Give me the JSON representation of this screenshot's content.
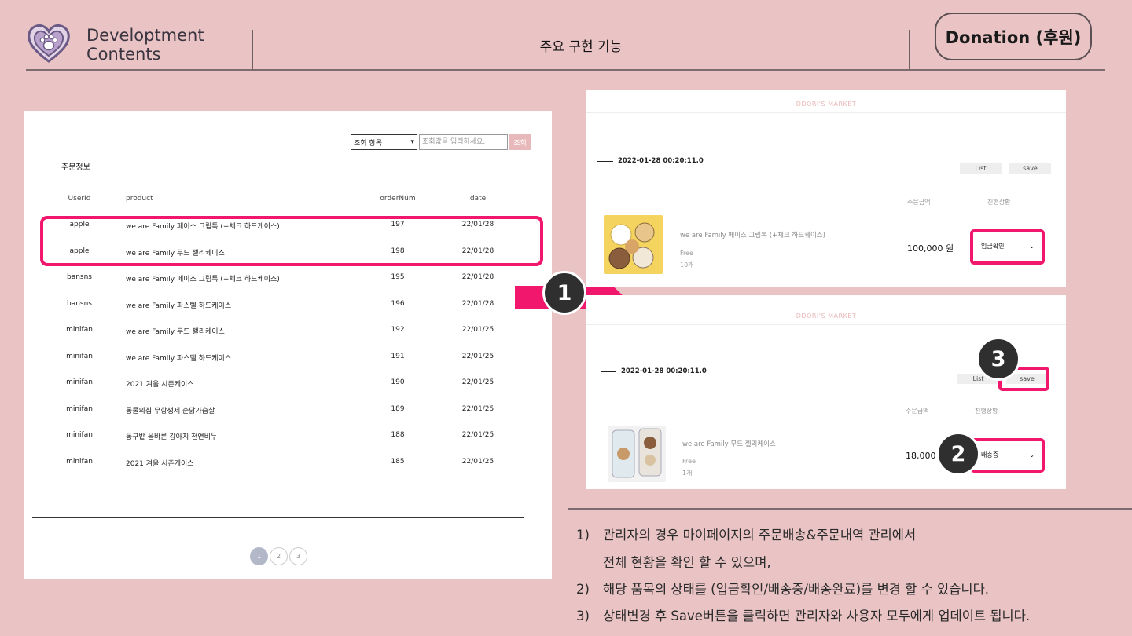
{
  "header": {
    "brand_line1": "Developtment",
    "brand_line2": "Contents",
    "title": "주요 구현 기능",
    "donation_label": "Donation (후원)"
  },
  "colors": {
    "background": "#eac4c5",
    "highlight": "#f1176c",
    "badge": "#2f2f2f"
  },
  "admin": {
    "search_select_value": "조회 항목",
    "search_placeholder": "조회값을 입력하세요.",
    "search_button": "조회",
    "section_title": "주문정보",
    "columns": [
      "UserId",
      "product",
      "orderNum",
      "date"
    ],
    "rows": [
      {
        "user": "apple",
        "product": "we are Family 페이스 그립톡 (+체크 하드케이스)",
        "num": "197",
        "date": "22/01/28"
      },
      {
        "user": "apple",
        "product": "we are Family 무드 젤리케이스",
        "num": "198",
        "date": "22/01/28"
      },
      {
        "user": "bansns",
        "product": "we are Family 페이스 그립톡 (+체크 하드케이스)",
        "num": "195",
        "date": "22/01/28"
      },
      {
        "user": "bansns",
        "product": "we are Family 파스텔 하드케이스",
        "num": "196",
        "date": "22/01/28"
      },
      {
        "user": "minifan",
        "product": "we are Family 무드 젤리케이스",
        "num": "192",
        "date": "22/01/25"
      },
      {
        "user": "minifan",
        "product": "we are Family 파스텔 하드케이스",
        "num": "191",
        "date": "22/01/25"
      },
      {
        "user": "minifan",
        "product": "2021 겨울 시즌케이스",
        "num": "190",
        "date": "22/01/25"
      },
      {
        "user": "minifan",
        "product": "동물의집 무항생제 순닭가슴살",
        "num": "189",
        "date": "22/01/25"
      },
      {
        "user": "minifan",
        "product": "동구밭 올바른 강아지 천연비누",
        "num": "188",
        "date": "22/01/25"
      },
      {
        "user": "minifan",
        "product": "2021 겨울 시즌케이스",
        "num": "185",
        "date": "22/01/25"
      }
    ],
    "pages": [
      "1",
      "2",
      "3"
    ],
    "active_page": "1"
  },
  "badges": [
    "1",
    "2",
    "3"
  ],
  "order1": {
    "market": "DDORI'S MARKET",
    "timestamp": "2022-01-28 00:20:11.0",
    "list_label": "List",
    "save_label": "save",
    "col_amount": "주문금액",
    "col_status": "진행상황",
    "product": "we are Family 페이스 그립톡 (+체크 하드케이스)",
    "option": "Free",
    "qty": "10개",
    "amount": "100,000 원",
    "status": "입금확인"
  },
  "order2": {
    "market": "DDORI'S MARKET",
    "timestamp": "2022-01-28 00:20:11.0",
    "list_label": "List",
    "save_label": "save",
    "col_amount": "주문금액",
    "col_status": "진행상황",
    "product": "we are Family 무드 젤리케이스",
    "option": "Free",
    "qty": "1개",
    "amount": "18,000",
    "status": "배송중"
  },
  "notes": [
    {
      "num": "1)",
      "text": "관리자의 경우 마이페이지의 주문배송&주문내역 관리에서"
    },
    {
      "num": "",
      "text": "전체 현황을 확인 할 수 있으며,"
    },
    {
      "num": "2)",
      "text": "해당 품목의 상태를 (입금확인/배송중/배송완료)를 변경 할 수 있습니다."
    },
    {
      "num": "3)",
      "text": "상태변경 후 Save버튼을 클릭하면 관리자와 사용자 모두에게 업데이트 됩니다."
    }
  ]
}
